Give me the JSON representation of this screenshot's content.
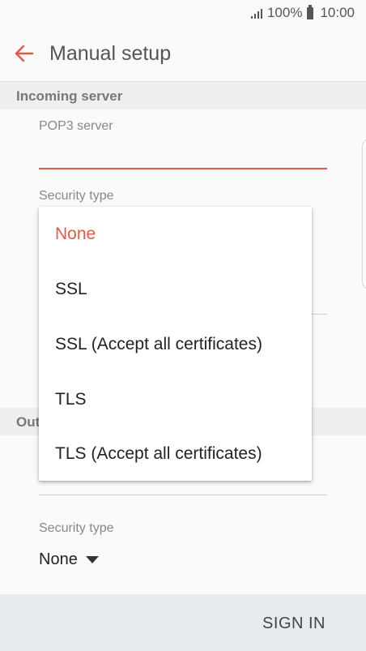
{
  "status": {
    "battery_percent": "100%",
    "time": "10:00"
  },
  "appbar": {
    "title": "Manual setup"
  },
  "incoming": {
    "header": "Incoming server",
    "server_label": "POP3 server",
    "server_value": "",
    "security_label": "Security type"
  },
  "outgoing": {
    "header_visible": "Out",
    "security_label": "Security type",
    "security_value": "None"
  },
  "dropdown": {
    "selected_index": 0,
    "options": [
      "None",
      "SSL",
      "SSL (Accept all certificates)",
      "TLS",
      "TLS (Accept all certificates)"
    ]
  },
  "footer": {
    "signin_label": "SIGN IN"
  },
  "colors": {
    "accent": "#e05a44",
    "header_bg": "#efefef",
    "footer_bg": "#e8ebed"
  },
  "icons": {
    "back": "arrow-left-icon",
    "signal": "signal-icon",
    "battery": "battery-icon",
    "caret": "caret-down-icon"
  }
}
